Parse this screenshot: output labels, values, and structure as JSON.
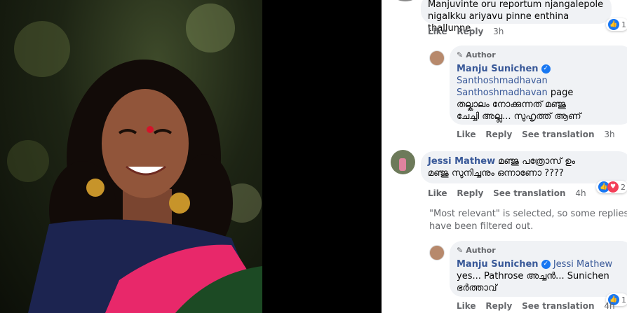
{
  "comment1": {
    "text_line1": "Manjuvinte oru reportum njangalepole",
    "text_line2": "nigalkku ariyavu pinne enthina thallunne",
    "like": "Like",
    "reply": "Reply",
    "time": "3h",
    "reaction_count": "1"
  },
  "reply1": {
    "badge": "Author",
    "name": "Manju Sunichen",
    "mention_line1": "Santhoshmadhavan",
    "mention_line2": "Santhoshmadhavan",
    "suffix": "page",
    "text_line1": "തല്കാലം നോക്കുന്നത് മഞ്ജു",
    "text_line2": "ചേച്ചി അല്ല... സുഹൃത്ത് ആണ്",
    "like": "Like",
    "reply": "Reply",
    "translate": "See translation",
    "time": "3h"
  },
  "comment2": {
    "name": "Jessi Mathew",
    "text_line1": "മഞ്ജു പത്രോസ് ഉം",
    "text_line2": "മഞ്ജു സുനിച്ചനും ഒന്നാണോ ????",
    "like": "Like",
    "reply": "Reply",
    "translate": "See translation",
    "time": "4h",
    "reaction_count": "2"
  },
  "filter_notice": {
    "line1": "\"Most relevant\" is selected, so some replies m",
    "line2": "have been filtered out."
  },
  "reply2": {
    "badge": "Author",
    "name": "Manju Sunichen",
    "mention": "Jessi Mathew",
    "text_line1": "yes... Pathrose അച്ചൻ... Sunichen",
    "text_line2": "ഭർത്താവ്",
    "like": "Like",
    "reply": "Reply",
    "translate": "See translation",
    "time": "4h",
    "reaction_count": "1"
  },
  "colors": {
    "link": "#385898",
    "bubble": "#f0f2f5",
    "like_blue": "#1877f2",
    "love_red": "#f33e58"
  }
}
